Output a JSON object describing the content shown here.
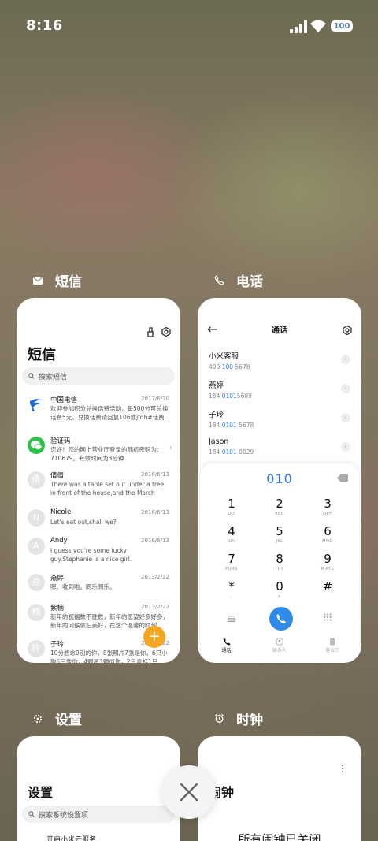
{
  "status_bar": {
    "time": "8:16",
    "battery": "100"
  },
  "apps": {
    "sms": {
      "label": "短信",
      "title": "短信",
      "search_placeholder": "搜索短信",
      "messages": [
        {
          "avatar": "",
          "name": "中国电信",
          "date": "2017/6/30",
          "text": "欢迎参加积分兑换话费活动，每500分可兑换话费5元，兑换话费请回复106或jfdh#话费..."
        },
        {
          "avatar": "",
          "name": "验证码",
          "date": "",
          "text": "您好！您的网上营业厅登录的随机密码为：710679。有效时间为3分钟"
        },
        {
          "avatar": "倩",
          "name": "倩倩",
          "date": "2016/6/13",
          "text": "There was a table set out under a tree in front of the house,and the March Hare an..."
        },
        {
          "avatar": "N",
          "name": "Nicole",
          "date": "2016/6/13",
          "text": "Let's eat out,shall we?"
        },
        {
          "avatar": "A",
          "name": "Andy",
          "date": "2016/6/13",
          "text": "I guess you're some lucky guy.Stephanie is a nice girl."
        },
        {
          "avatar": "燕",
          "name": "燕婷",
          "date": "2013/2/22",
          "text": "嗯。收到啦。同乐同乐。"
        },
        {
          "avatar": "楠",
          "name": "紫楠",
          "date": "2013/2/22",
          "text": "新年的祝福数不胜数，新年的愿望好多好多，新年的问候依旧美好，在这个温馨的时刻..."
        },
        {
          "avatar": "玲",
          "name": "子玲",
          "date": "2013/2/22",
          "text": "10分想念9别的你，8张照片7张是你，6只小狗5只像你，4颗星3颗似你，2只青蛙1只..."
        }
      ],
      "fab": "+"
    },
    "phone": {
      "label": "电话",
      "title": "通话",
      "contacts": [
        {
          "name": "小米客服",
          "num_pre": "400 ",
          "num_hl": "100",
          "num_post": " 5678"
        },
        {
          "name": "燕婷",
          "num_pre": "184 ",
          "num_hl": "0101",
          "num_post": "5689"
        },
        {
          "name": "子玲",
          "num_pre": "184 ",
          "num_hl": "0101",
          "num_post": " 5678"
        },
        {
          "name": "Jason",
          "num_pre": "184 ",
          "num_hl": "0101",
          "num_post": " 0029"
        }
      ],
      "dialed_number": "010",
      "keys": [
        {
          "d": "1",
          "l": "QO"
        },
        {
          "d": "2",
          "l": "ABC"
        },
        {
          "d": "3",
          "l": "DEF"
        },
        {
          "d": "4",
          "l": "GHI"
        },
        {
          "d": "5",
          "l": "JKL"
        },
        {
          "d": "6",
          "l": "MNO"
        },
        {
          "d": "7",
          "l": "PQRS"
        },
        {
          "d": "8",
          "l": "TUV"
        },
        {
          "d": "9",
          "l": "WXYZ"
        },
        {
          "d": "*",
          "l": ","
        },
        {
          "d": "0",
          "l": "+"
        },
        {
          "d": "#",
          "l": ""
        }
      ],
      "tabs": [
        "通话",
        "联系人",
        "营业厅"
      ]
    },
    "settings": {
      "label": "设置",
      "title": "设置",
      "search_placeholder": "搜索系统设置项",
      "first_item": "开启小米云服务"
    },
    "clock": {
      "label": "时钟",
      "title": "闹钟",
      "message": "所有闹钟已关闭"
    }
  },
  "colors": {
    "accent": "#2f7de8",
    "fab": "#f5a623"
  }
}
